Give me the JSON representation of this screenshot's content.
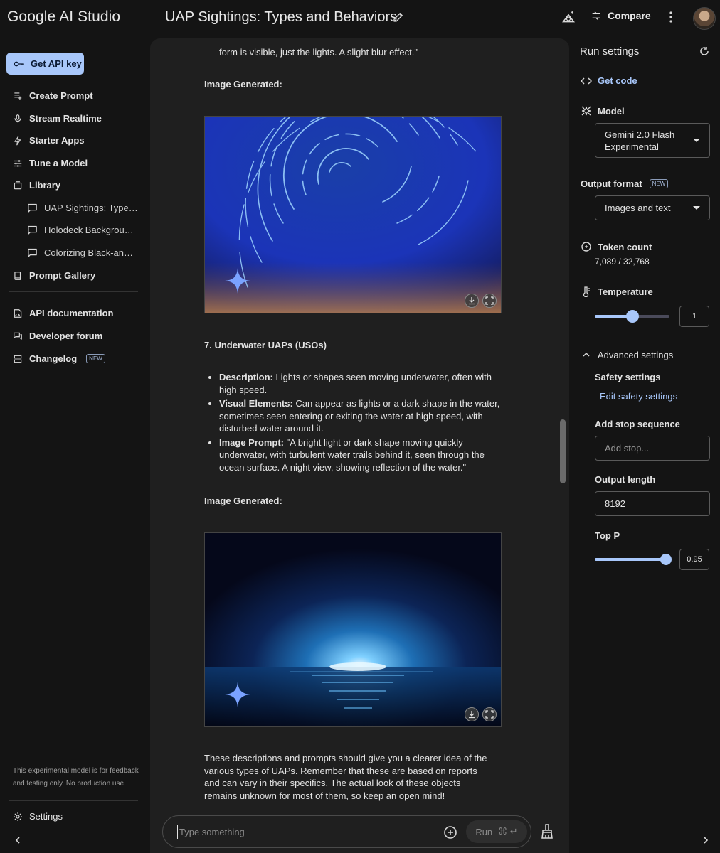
{
  "app": {
    "logo": "Google AI Studio",
    "title": "UAP Sightings: Types and Behaviors",
    "compare_label": "Compare"
  },
  "sidebar": {
    "api_key_label": "Get API key",
    "items": [
      {
        "label": "Create Prompt",
        "icon": "create-prompt-icon"
      },
      {
        "label": "Stream Realtime",
        "icon": "mic-icon"
      },
      {
        "label": "Starter Apps",
        "icon": "bolt-icon"
      },
      {
        "label": "Tune a Model",
        "icon": "tune-icon"
      },
      {
        "label": "Library",
        "icon": "library-icon"
      }
    ],
    "library_items": [
      "UAP Sightings: Types and Behaviors",
      "Holodeck Background Generation",
      "Colorizing Black-and-White Photos"
    ],
    "prompt_gallery": "Prompt Gallery",
    "resources": [
      {
        "label": "API documentation",
        "icon": "docs-icon"
      },
      {
        "label": "Developer forum",
        "icon": "forum-icon"
      },
      {
        "label": "Changelog",
        "icon": "changelog-icon",
        "badge": "NEW"
      }
    ],
    "disclaimer": "This experimental model is for feedback and testing only. No production use.",
    "settings_label": "Settings"
  },
  "chat": {
    "top_text": "form is visible, just the lights. A slight blur effect.\"",
    "image_generated_label": "Image Generated:",
    "section_heading": "7. Underwater UAPs (USOs)",
    "bullets": [
      {
        "label": "Description:",
        "text": " Lights or shapes seen moving underwater, often with high speed."
      },
      {
        "label": "Visual Elements:",
        "text": " Can appear as lights or a dark shape in the water, sometimes seen entering or exiting the water at high speed, with disturbed water around it."
      },
      {
        "label": "Image Prompt:",
        "text": " \"A bright light or dark shape moving quickly underwater, with turbulent water trails behind it, seen through the ocean surface. A night view, showing reflection of the water.\""
      }
    ],
    "closing_text": "These descriptions and prompts should give you a clearer idea of the various types of UAPs. Remember that these are based on reports and can vary in their specifics. The actual look of these objects remains unknown for most of them, so keep an open mind!",
    "input_placeholder": "Type something",
    "run_label": "Run",
    "run_shortcut": "⌘ ↵"
  },
  "run_settings": {
    "title": "Run settings",
    "get_code": "Get code",
    "model_label": "Model",
    "model_value": "Gemini 2.0 Flash Experimental",
    "output_format_label": "Output format",
    "output_format_badge": "NEW",
    "output_format_value": "Images and text",
    "token_count_label": "Token count",
    "token_count_value": "7,089 / 32,768",
    "temperature_label": "Temperature",
    "temperature_value": "1",
    "temperature_fraction": 0.5,
    "advanced_label": "Advanced settings",
    "safety_label": "Safety settings",
    "edit_safety": "Edit safety settings",
    "stop_label": "Add stop sequence",
    "stop_placeholder": "Add stop...",
    "output_length_label": "Output length",
    "output_length_value": "8192",
    "top_p_label": "Top P",
    "top_p_value": "0.95",
    "top_p_fraction": 0.95
  },
  "colors": {
    "accent": "#a8c7fa",
    "background": "#141414",
    "panel": "#1f1f1f"
  }
}
